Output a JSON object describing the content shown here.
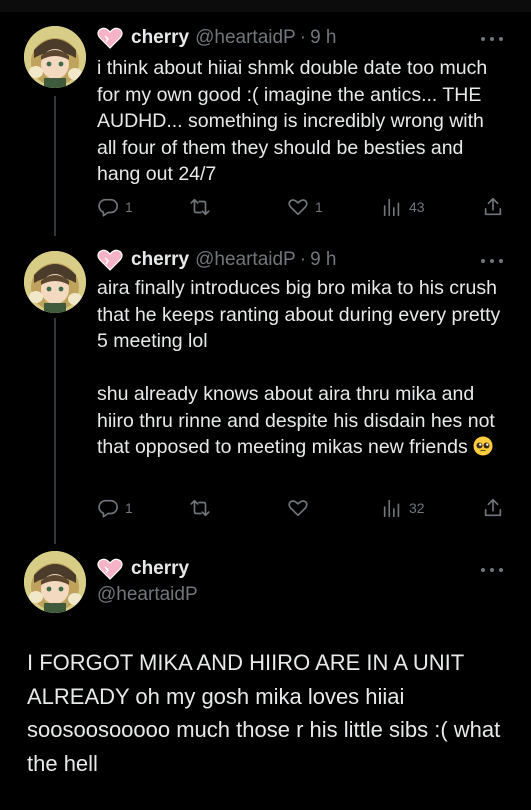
{
  "tweets": [
    {
      "name": "cherry",
      "handle": "@heartaidP",
      "dot": "·",
      "time": "9 h",
      "text": "i think about hiiai shmk double date too much for my own good :( imagine the antics... THE AUDHD... something is incredibly wrong with all four of them they should be besties and hang out 24/7",
      "replies": "1",
      "retweets": "",
      "likes": "1",
      "views": "43"
    },
    {
      "name": "cherry",
      "handle": "@heartaidP",
      "dot": "·",
      "time": "9 h",
      "text_p1": "aira finally introduces big bro mika to his crush that he keeps ranting about during every pretty 5 meeting lol",
      "text_p2": "shu already knows about aira thru mika and hiiro thru rinne and despite his disdain hes not that opposed to meeting mikas new friends ",
      "emoji": "pleading-face",
      "replies": "1",
      "retweets": "",
      "likes": "",
      "views": "32"
    }
  ],
  "main_tweet": {
    "name": "cherry",
    "handle": "@heartaidP",
    "text": "I FORGOT MIKA AND HIIRO ARE IN A UNIT ALREADY oh my gosh mika loves hiiai soosoosooooo much those r his little sibs :( what the hell"
  },
  "colors": {
    "background": "#000000",
    "text": "#e7e9ea",
    "secondary": "#71767b",
    "thread_line": "#333639",
    "heart_pink": "#f6b3c8"
  },
  "icons": [
    "reply-icon",
    "retweet-icon",
    "like-icon",
    "views-icon",
    "share-icon",
    "more-icon",
    "heart-emoji-icon",
    "pleading-face-emoji"
  ]
}
